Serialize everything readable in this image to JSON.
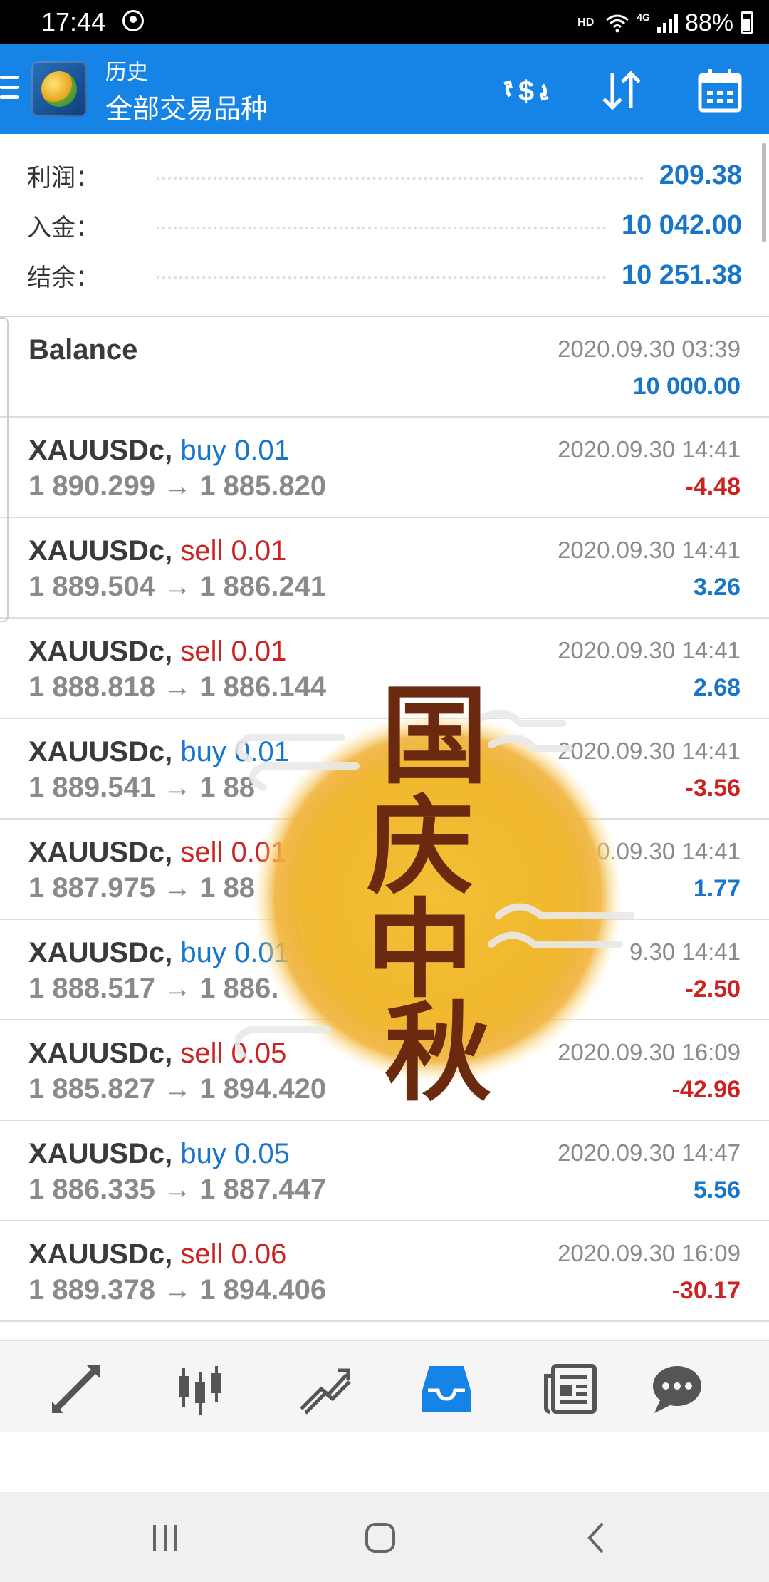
{
  "status": {
    "time": "17:44",
    "network": "HD",
    "lte": "4G",
    "battery": "88%"
  },
  "header": {
    "subtitle": "历史",
    "title": "全部交易品种"
  },
  "summary": [
    {
      "label": "利润：",
      "value": "209.38"
    },
    {
      "label": "入金：",
      "value": "10 042.00"
    },
    {
      "label": "结余：",
      "value": "10 251.38"
    }
  ],
  "balance_row": {
    "title": "Balance",
    "date": "2020.09.30 03:39",
    "amount": "10 000.00"
  },
  "trades": [
    {
      "symbol": "XAUUSDc,",
      "side": "buy 0.01",
      "side_type": "buy",
      "open": "1 890.299",
      "close": "1 885.820",
      "date": "2020.09.30 14:41",
      "profit": "-4.48"
    },
    {
      "symbol": "XAUUSDc,",
      "side": "sell 0.01",
      "side_type": "sell",
      "open": "1 889.504",
      "close": "1 886.241",
      "date": "2020.09.30 14:41",
      "profit": "3.26"
    },
    {
      "symbol": "XAUUSDc,",
      "side": "sell 0.01",
      "side_type": "sell",
      "open": "1 888.818",
      "close": "1 886.144",
      "date": "2020.09.30 14:41",
      "profit": "2.68"
    },
    {
      "symbol": "XAUUSDc,",
      "side": "buy 0.01",
      "side_type": "buy",
      "open": "1 889.541",
      "close": "1 88",
      "date": "2020.09.30 14:41",
      "profit": "-3.56"
    },
    {
      "symbol": "XAUUSDc,",
      "side": "sell 0.01",
      "side_type": "sell",
      "open": "1 887.975",
      "close": "1 88",
      "date": "0.09.30 14:41",
      "profit": "1.77"
    },
    {
      "symbol": "XAUUSDc,",
      "side": "buy 0.01",
      "side_type": "buy",
      "open": "1 888.517",
      "close": "1 886.",
      "date": "9.30 14:41",
      "profit": "-2.50"
    },
    {
      "symbol": "XAUUSDc,",
      "side": "sell 0.05",
      "side_type": "sell",
      "open": "1 885.827",
      "close": "1 894.420",
      "date": "2020.09.30 16:09",
      "profit": "-42.96"
    },
    {
      "symbol": "XAUUSDc,",
      "side": "buy 0.05",
      "side_type": "buy",
      "open": "1 886.335",
      "close": "1 887.447",
      "date": "2020.09.30 14:47",
      "profit": "5.56"
    },
    {
      "symbol": "XAUUSDc,",
      "side": "sell 0.06",
      "side_type": "sell",
      "open": "1 889.378",
      "close": "1 894.406",
      "date": "2020.09.30 16:09",
      "profit": "-30.17"
    }
  ],
  "arrow": "→",
  "watermark": {
    "text": [
      "国",
      "庆",
      "中",
      "秋"
    ]
  },
  "tabs": [
    "quotes-icon",
    "chart-icon",
    "trade-icon",
    "history-icon",
    "news-icon",
    "chat-icon"
  ],
  "colors": {
    "accent": "#1683e6",
    "positive": "#1776c9",
    "negative": "#cc2222"
  }
}
